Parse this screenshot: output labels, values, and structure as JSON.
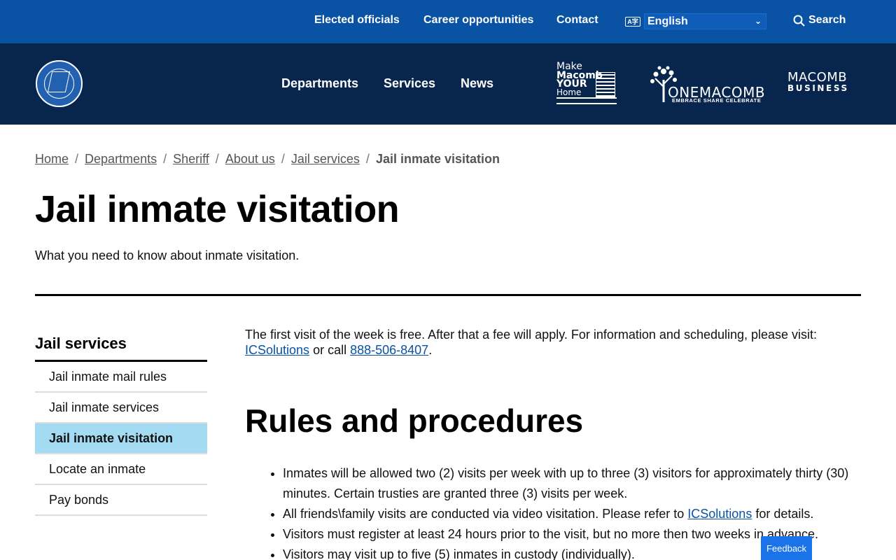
{
  "topbar": {
    "links": [
      "Elected officials",
      "Career opportunities",
      "Contact"
    ],
    "language_icon": "language-icon",
    "language_value": "English",
    "search_label": "Search"
  },
  "mainnav": {
    "items": [
      "Departments",
      "Services",
      "News"
    ],
    "logo_make": {
      "line1": "Make",
      "line2": "Macomb",
      "line3": "YOUR",
      "line4": "Home"
    },
    "logo_one": {
      "word": "ONEMACOMB",
      "tagline": "EMBRACE SHARE CELEBRATE"
    },
    "logo_business": {
      "line1": "MACOMB",
      "line2": "BUSINESS"
    }
  },
  "breadcrumb": {
    "items": [
      "Home",
      "Departments",
      "Sheriff",
      "About us",
      "Jail services"
    ],
    "current": "Jail inmate visitation"
  },
  "page": {
    "title": "Jail inmate visitation",
    "subtitle": "What you need to know about inmate visitation."
  },
  "sidebar": {
    "heading": "Jail services",
    "items": [
      {
        "label": "Jail inmate mail rules"
      },
      {
        "label": "Jail inmate services"
      },
      {
        "label": "Jail inmate visitation"
      },
      {
        "label": "Locate an inmate"
      },
      {
        "label": "Pay bonds"
      }
    ],
    "active_index": 2
  },
  "content": {
    "intro_text": "The first visit of the week is free. After that a fee will apply.  For information and scheduling, please visit: ",
    "intro_link": "ICSolutions",
    "intro_mid": " or call ",
    "intro_phone": "888-506-8407",
    "intro_end": ".",
    "section_title": "Rules and procedures",
    "rules": {
      "r1": "Inmates will be allowed two (2) visits per week with up to three (3) visitors for approximately thirty (30) minutes. Certain trusties are granted three (3) visits per week.",
      "r2_pre": "All friends\\family visits are conducted via video visitation. Please refer to ",
      "r2_link": "ICSolutions",
      "r2_post": " for details.",
      "r3": "Visitors must register at least 24 hours prior to the visit, but no more then two weeks in advance.",
      "r4": "Visitors may visit up to five (5) inmates in custody (individually)."
    }
  },
  "feedback": {
    "label": "Feedback"
  },
  "colors": {
    "topbar": "#0a52a3",
    "mainnav": "#07254d",
    "active_sidebar": "#a3dcf2",
    "link": "#0a52a3",
    "feedback": "#1a73e8"
  }
}
